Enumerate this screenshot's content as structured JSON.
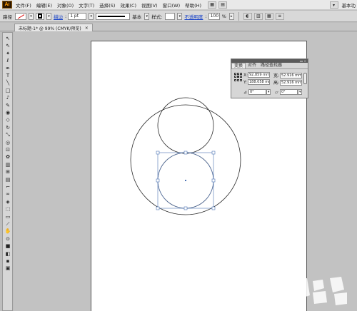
{
  "app": {
    "logo": "Ai"
  },
  "menu": [
    {
      "label": "文件(F)",
      "w": 0
    },
    {
      "label": "编辑(E)"
    },
    {
      "label": "对象(O)"
    },
    {
      "label": "文字(T)"
    },
    {
      "label": "选择(S)"
    },
    {
      "label": "效果(C)"
    },
    {
      "label": "视图(V)"
    },
    {
      "label": "窗口(W)"
    },
    {
      "label": "帮助(H)"
    }
  ],
  "workspace_label": "基本功",
  "control_bar": {
    "object_type": "路径",
    "stroke_link": "描边",
    "stroke_weight": "1 pt",
    "brush_label": "基本",
    "style_label": "样式:",
    "opacity_link": "不透明度",
    "opacity_value": "100",
    "opacity_unit": "%"
  },
  "doc_tab": {
    "title": "未标题-1* @ 99% (CMYK/预览)",
    "close": "×"
  },
  "transform_panel": {
    "tabs": [
      "变换",
      "对齐",
      "路径查找器"
    ],
    "x_label": "X:",
    "x_value": "92.859 mm",
    "y_label": "Y:",
    "y_value": "188.058 mm",
    "w_label": "宽:",
    "w_value": "52.916 mm",
    "h_label": "高:",
    "h_value": "52.916 mm",
    "rotate_value": "0°",
    "shear_value": "0°"
  },
  "colors": {
    "menu_bg": "#e9e9e9",
    "control_bg": "#d8d8d8",
    "canvas_bg": "#c2c2c2",
    "selection_blue": "#4c73b5",
    "link_blue": "#1a44c8"
  },
  "tools": [
    "selection-tool",
    "direct-selection-tool",
    "magic-wand-tool",
    "lasso-tool",
    "pen-tool",
    "type-tool",
    "line-tool",
    "rectangle-tool",
    "paintbrush-tool",
    "pencil-tool",
    "blob-brush-tool",
    "eraser-tool",
    "rotate-tool",
    "scale-tool",
    "warp-tool",
    "free-transform-tool",
    "symbol-sprayer-tool",
    "column-graph-tool",
    "mesh-tool",
    "gradient-tool",
    "eyedropper-tool",
    "blend-tool",
    "live-paint-tool",
    "live-paint-selection-tool",
    "artboard-tool",
    "slice-tool",
    "hand-tool",
    "zoom-tool",
    "fill-stroke-swatch",
    "default-colors",
    "color-mode",
    "screen-mode"
  ]
}
